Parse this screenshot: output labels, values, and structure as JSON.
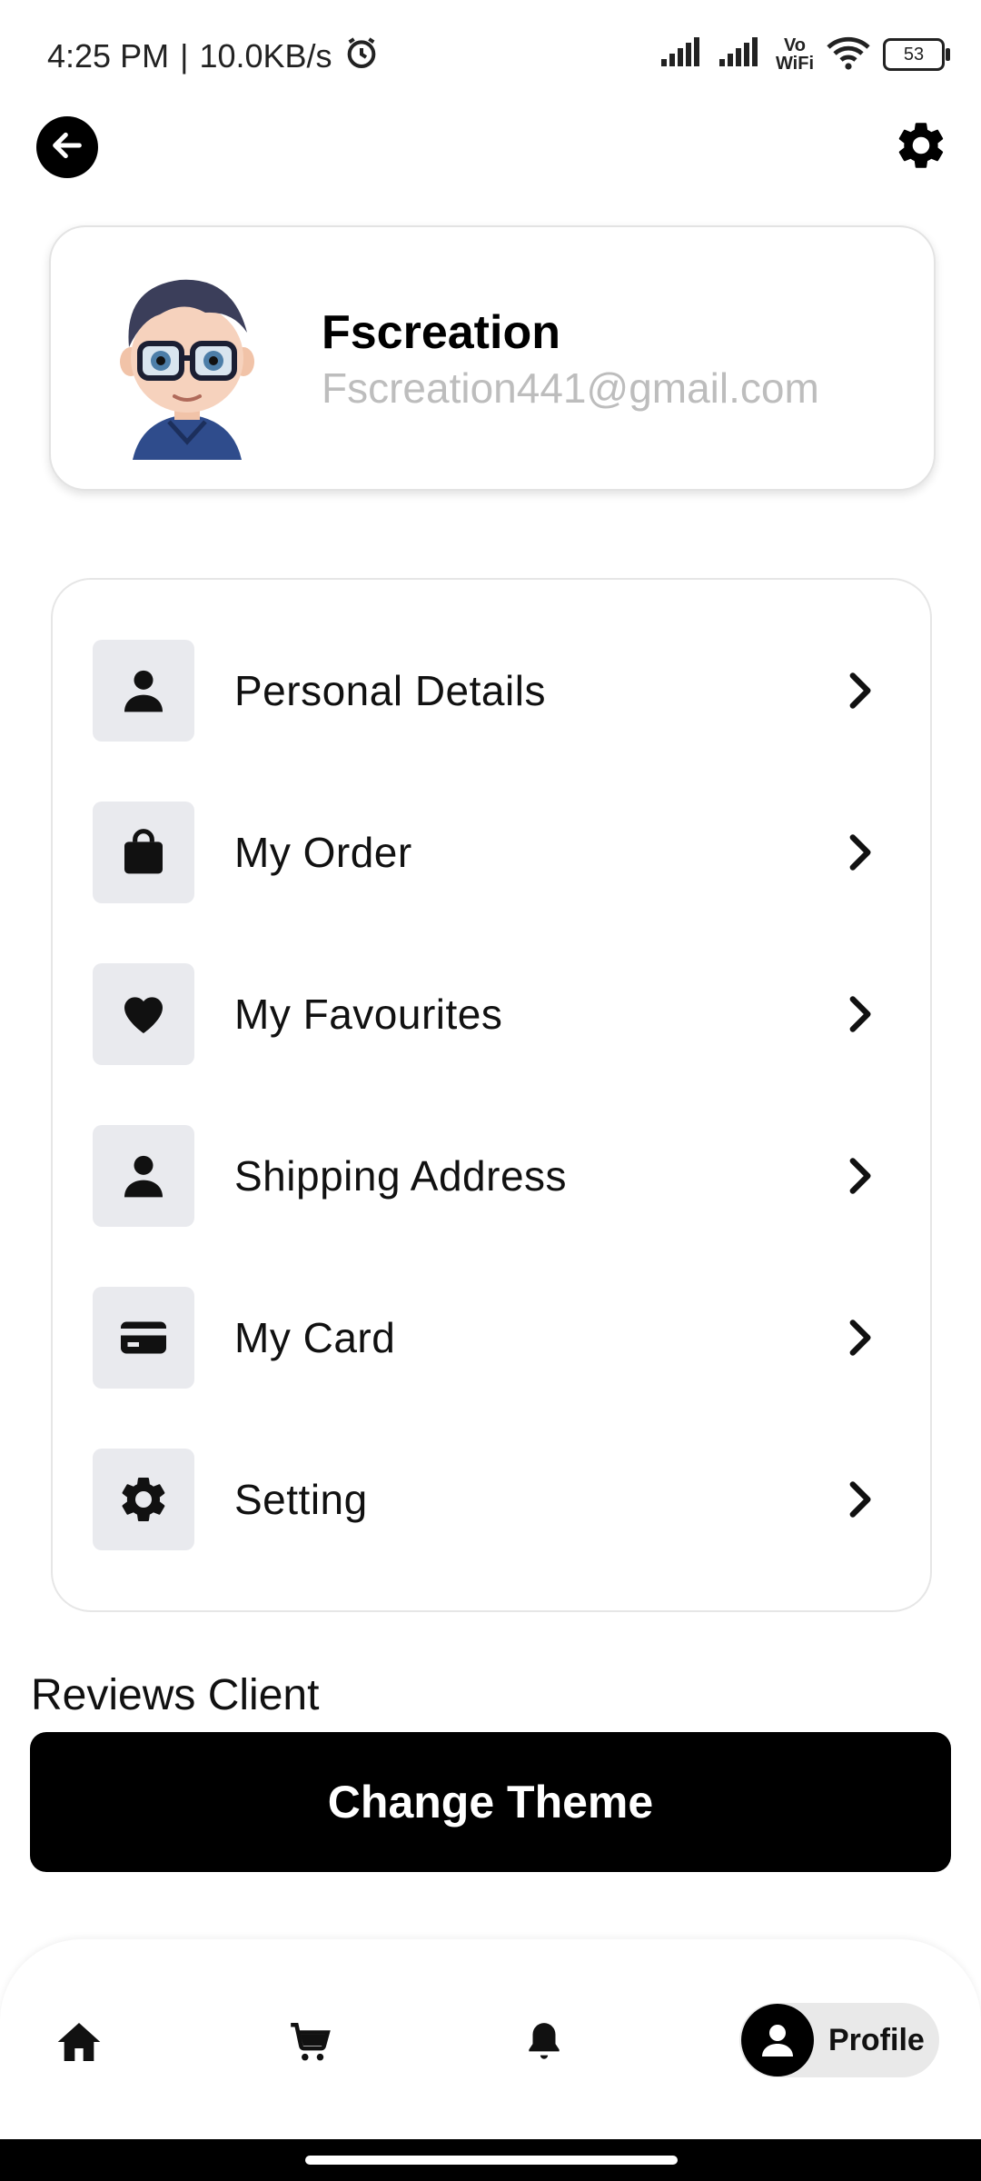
{
  "status_bar": {
    "time": "4:25 PM",
    "speed": "10.0KB/s",
    "separator": "|",
    "vowifi_line1": "Vo",
    "vowifi_line2": "WiFi",
    "battery": "53"
  },
  "profile": {
    "name": "Fscreation",
    "email": "Fscreation441@gmail.com"
  },
  "menu": {
    "items": [
      {
        "label": "Personal Details",
        "icon": "person-icon"
      },
      {
        "label": "My Order",
        "icon": "shopping-bag-icon"
      },
      {
        "label": "My Favourites",
        "icon": "heart-icon"
      },
      {
        "label": "Shipping Address",
        "icon": "person-icon"
      },
      {
        "label": "My Card",
        "icon": "credit-card-icon"
      },
      {
        "label": "Setting",
        "icon": "gear-icon"
      }
    ]
  },
  "reviews": {
    "title": "Reviews Client"
  },
  "actions": {
    "change_theme": "Change Theme"
  },
  "bottom_nav": {
    "profile_label": "Profile"
  },
  "colors": {
    "accent": "#000000",
    "icon_bg": "#e9eaee",
    "email_text": "#bdbdbd"
  }
}
